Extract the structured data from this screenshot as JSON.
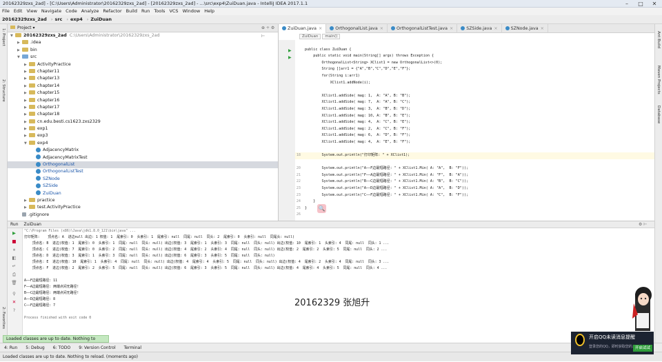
{
  "window": {
    "title": "20162329zxs_2ad] - [C:\\Users\\Administrator\\20162329zxs_2ad] - [20162329zxs_2ad] - ...\\src\\exp4\\ZuiDuan.java - IntelliJ IDEA 2017.1.1"
  },
  "menu": [
    "File",
    "Edit",
    "View",
    "Navigate",
    "Code",
    "Analyze",
    "Refactor",
    "Build",
    "Run",
    "Tools",
    "VCS",
    "Window",
    "Help"
  ],
  "breadcrumb": [
    "20162329zxs_2ad",
    "src",
    "exp4",
    "ZuiDuan"
  ],
  "left_tabs": [
    "1: Project",
    "2: Structure",
    "2: Favorites"
  ],
  "right_tabs": [
    "Ant Build",
    "Maven Projects",
    "Database"
  ],
  "project": {
    "header": "Project",
    "rows": [
      {
        "t": "20162329zxs_2ad",
        "extra": "C:\\Users\\Administrator\\20162329zxs_2ad",
        "d": 0,
        "kind": "folder",
        "open": true
      },
      {
        "t": ".idea",
        "d": 1,
        "kind": "folder"
      },
      {
        "t": "bin",
        "d": 1,
        "kind": "folder"
      },
      {
        "t": "src",
        "d": 1,
        "kind": "src",
        "open": true
      },
      {
        "t": "ActivityPractice",
        "d": 2,
        "kind": "folder"
      },
      {
        "t": "chapter11",
        "d": 2,
        "kind": "folder"
      },
      {
        "t": "chapter13",
        "d": 2,
        "kind": "folder"
      },
      {
        "t": "chapter14",
        "d": 2,
        "kind": "folder"
      },
      {
        "t": "chapter15",
        "d": 2,
        "kind": "folder"
      },
      {
        "t": "chapter16",
        "d": 2,
        "kind": "folder"
      },
      {
        "t": "chapter17",
        "d": 2,
        "kind": "folder"
      },
      {
        "t": "chapter18",
        "d": 2,
        "kind": "folder"
      },
      {
        "t": "cn.edu.besti.cs1623.zxs2329",
        "d": 2,
        "kind": "folder"
      },
      {
        "t": "exp1",
        "d": 2,
        "kind": "folder"
      },
      {
        "t": "exp3",
        "d": 2,
        "kind": "folder"
      },
      {
        "t": "exp4",
        "d": 2,
        "kind": "folder",
        "open": true
      },
      {
        "t": "AdjacencyMatrix",
        "d": 3,
        "kind": "class"
      },
      {
        "t": "AdjacencyMatrixTest",
        "d": 3,
        "kind": "class"
      },
      {
        "t": "OrthogonalList",
        "d": 3,
        "kind": "class",
        "sel": true
      },
      {
        "t": "OrthogonalListTest",
        "d": 3,
        "kind": "class"
      },
      {
        "t": "SZNode",
        "d": 3,
        "kind": "class"
      },
      {
        "t": "SZSide",
        "d": 3,
        "kind": "class"
      },
      {
        "t": "ZuiDuan",
        "d": 3,
        "kind": "class"
      },
      {
        "t": "practice",
        "d": 2,
        "kind": "folder"
      },
      {
        "t": "test.ActivityPractice",
        "d": 2,
        "kind": "folder"
      },
      {
        "t": ".gitignore",
        "d": 1,
        "kind": "file"
      }
    ]
  },
  "tabs": [
    {
      "label": "ZuiDuan.java",
      "active": true
    },
    {
      "label": "OrthogonalList.java"
    },
    {
      "label": "OrthogonalListTest.java"
    },
    {
      "label": "SZSide.java"
    },
    {
      "label": "SZNode.java"
    }
  ],
  "editor_crumb": [
    "ZuiDuan",
    "main()"
  ],
  "code": [
    {
      "n": "",
      "t": ""
    },
    {
      "n": "",
      "t": "public class ZuiDuan {"
    },
    {
      "n": "",
      "t": "    public static void main(String[] args) throws Exception {"
    },
    {
      "n": "",
      "t": "        OrthogonalList<String> XClist1 = new OrthogonalList<>(0);"
    },
    {
      "n": "",
      "t": "        String []arr1 = {\"A\",\"B\",\"C\",\"D\",\"E\",\"F\"};"
    },
    {
      "n": "",
      "t": "        for(String i:arr1)"
    },
    {
      "n": "",
      "t": "            XClist1.addNode(i);"
    },
    {
      "n": "",
      "t": ""
    },
    {
      "n": "",
      "t": "        XClist1.addSide( mag: 1,  A: \"A\", B: \"B\");"
    },
    {
      "n": "",
      "t": "        XClist1.addSide( mag: 7,  A: \"A\", B: \"C\");"
    },
    {
      "n": "",
      "t": "        XClist1.addSide( mag: 3,  A: \"B\", B: \"D\");"
    },
    {
      "n": "",
      "t": "        XClist1.addSide( mag: 10, A: \"B\", B: \"E\");"
    },
    {
      "n": "",
      "t": "        XClist1.addSide( mag: 4,  A: \"C\", B: \"E\");"
    },
    {
      "n": "",
      "t": "        XClist1.addSide( mag: 2,  A: \"C\", B: \"F\");"
    },
    {
      "n": "",
      "t": "        XClist1.addSide( mag: 6,  A: \"D\", B: \"F\");"
    },
    {
      "n": "",
      "t": "        XClist1.addSide( mag: 4,  A: \"E\", B: \"F\");"
    },
    {
      "n": "",
      "t": ""
    },
    {
      "n": "18",
      "t": "        System.out.println(\"打印矩阵: \" + XClist1);",
      "hl": true
    },
    {
      "n": "",
      "t": ""
    },
    {
      "n": "20",
      "t": "        System.out.println(\"A——F边最短路径: \" + XClist1.Min( A: \"A\",  B: \"F\"));"
    },
    {
      "n": "21",
      "t": "        System.out.println(\"F——A边最短路径: \" + XClist1.Min( A: \"F\",  B: \"A\"));"
    },
    {
      "n": "22",
      "t": "        System.out.println(\"B——C边最短路径: \" + XClist1.Min( A: \"B\",  B: \"C\"));"
    },
    {
      "n": "23",
      "t": "        System.out.println(\"A——D边最短路径: \" + XClist1.Min( A: \"A\",  B: \"D\"));"
    },
    {
      "n": "23",
      "t": "        System.out.println(\"C——F边最短路径: \" + XClist1.Min( A: \"C\",  B: \"F\"));"
    },
    {
      "n": "24",
      "t": "    }"
    },
    {
      "n": "25",
      "t": "}"
    },
    {
      "n": "26",
      "t": ""
    }
  ],
  "run": {
    "header": "Run",
    "config": "ZuiDuan",
    "lines": [
      {
        "t": "\"C:\\Program Files (x86)\\Java\\jdk1.8.0_121\\bin\\java\" ...",
        "cmd": true
      },
      {
        "t": "打印矩阵:    顶点名: A  进边null 出边: 1 权值: 1  尾索引: 0  头索引: 1  尾索引: null  同尾: null  同头: 2  尾索引: 0  头索引: null  同尾头: null)"
      },
      {
        "t": "    顶点名: B  进边(权值: 1  尾索引: 0  头索引: 1  同尾: null  同头: null) 出边(权值: 3  尾索引: 1  头索引: 3  同尾: null  同头: null) 出边(权值: 10  尾索引: 1  头索引: 4  同尾: null  同头: 1 ..."
      },
      {
        "t": "    顶点名: C  进边(权值: 7  尾索引: 0  头索引: 2  同尾: null  同头: null) 出边(权值: 4  尾索引: 2  头索引: 4  同尾: null  同头: null) 出边(权值: 2  尾索引: 2  头索引: 5  同尾: null  同头: 2 ..."
      },
      {
        "t": "    顶点名: D  进边(权值: 3  尾索引: 1  头索引: 3  同尾: null  同头: null) 出边(权值: 6  尾索引: 3  头索引: 5  同尾: null  同头: null)"
      },
      {
        "t": "    顶点名: E  进边(权值: 10  尾索引: 1  头索引: 4  同尾: null  同头: null) 出边(权值: 4  尾索引: 4  头索引: 5  同尾: null  同头: null) 出边(权值: 4  尾索引: 2  头索引: 4  同尾: null  同头: 3 ..."
      },
      {
        "t": "    顶点名: F  进边(权值: 2  尾索引: 2  头索引: 5  同尾: null  同头: null) 出边(权值: 6  尾索引: 3  头索引: 5  同尾: null  同头: null) 出边(权值: 4  尾索引: 4  头索引: 5  同尾: null  同头: 4 ..."
      },
      {
        "t": ""
      },
      {
        "t": "A——F边最短路径: 11"
      },
      {
        "t": "F——A边最短路径: 两端点间无路径!"
      },
      {
        "t": "B——C边最短路径: 两端点间无路径!"
      },
      {
        "t": "A——D边最短路径: 8"
      },
      {
        "t": "C——F边最短路径: 7"
      },
      {
        "t": ""
      },
      {
        "t": "Process finished with exit code 0",
        "cmd": true
      }
    ]
  },
  "signature": "20162329 张旭升",
  "balloon": "Loaded classes are up to date. Nothing to reload.",
  "toolwindows": [
    "4: Run",
    "5: Debug",
    "6: TODO",
    "9: Version Control",
    "Terminal"
  ],
  "statusbar": "Loaded classes are up to date. Nothing to reload. (moments ago)",
  "qq": {
    "title": "开启QQ未读消息提醒",
    "sub": "登录您的QQ，即时获取您的...",
    "btn": "开启试试"
  }
}
